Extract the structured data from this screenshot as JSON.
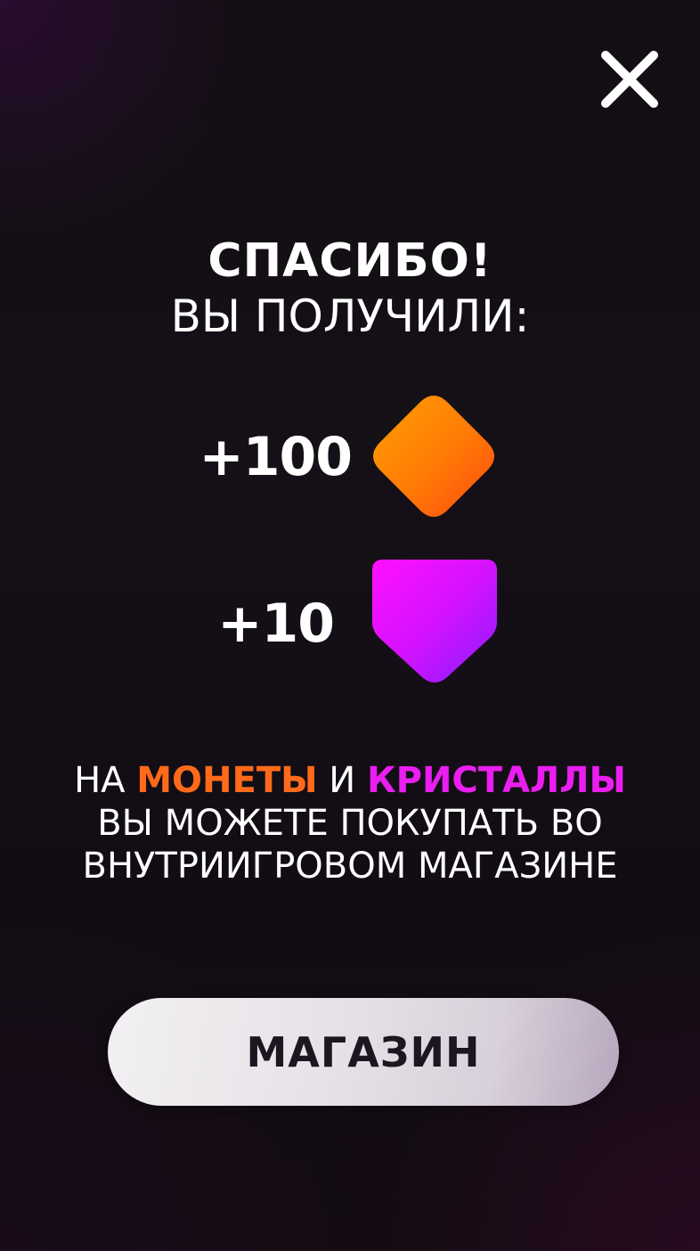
{
  "dialog": {
    "title": "СПАСИБО!",
    "subtitle": "ВЫ ПОЛУЧИЛИ:"
  },
  "rewards": [
    {
      "amount": "+100",
      "currency": "coins",
      "icon": "orange-diamond-coin-icon",
      "color": "#ff7a00"
    },
    {
      "amount": "+10",
      "currency": "crystals",
      "icon": "purple-crystal-icon",
      "color": "#d60cff"
    }
  ],
  "info": {
    "prefix": "НА",
    "coins_word": "МОНЕТЫ",
    "conjunction": "И",
    "crystals_word": "КРИСТАЛЛЫ",
    "line2": "ВЫ МОЖЕТЕ ПОКУПАТЬ ВО",
    "line3": "ВНУТРИИГРОВОМ МАГАЗИНЕ"
  },
  "shop_button": {
    "label": "МАГАЗИН"
  },
  "colors": {
    "coins_highlight": "#ff6a1a",
    "crystals_highlight": "#ea1ef0",
    "background": "#140f15",
    "button": "#e6e1e7",
    "button_text": "#1b1620"
  },
  "icons": {
    "close": "close-icon",
    "coin": "orange-diamond-coin-icon",
    "crystal": "purple-crystal-icon"
  }
}
